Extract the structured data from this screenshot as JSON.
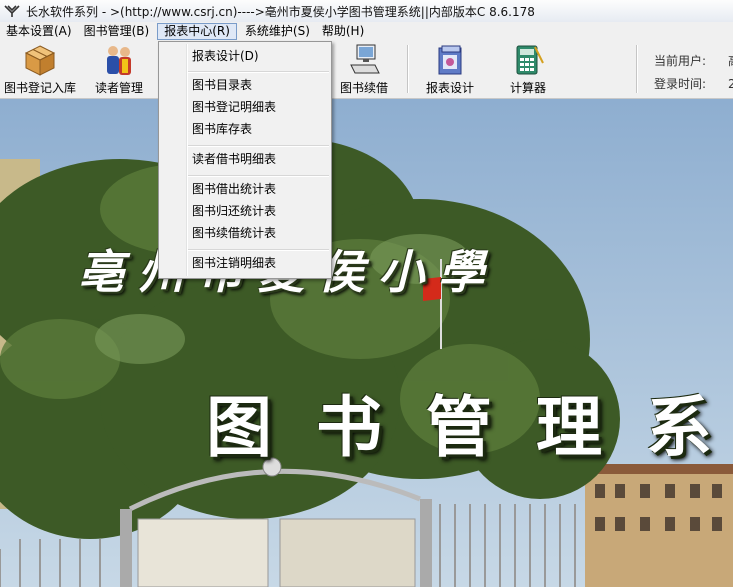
{
  "window": {
    "title": "长水软件系列 - >(http://www.csrj.cn)---->亳州市夏侯小学图书管理系统||内部版本C 8.6.178"
  },
  "menubar": {
    "items": [
      {
        "label": "基本设置(A)"
      },
      {
        "label": "图书管理(B)"
      },
      {
        "label": "报表中心(R)"
      },
      {
        "label": "系统维护(S)"
      },
      {
        "label": "帮助(H)"
      }
    ]
  },
  "toolbar": {
    "buttons": [
      {
        "label": "图书登记入库",
        "icon": "box-icon"
      },
      {
        "label": "读者管理",
        "icon": "readers-icon"
      },
      {
        "label": "图书续借",
        "icon": "computer-icon"
      },
      {
        "label": "报表设计",
        "icon": "report-design-icon"
      },
      {
        "label": "计算器",
        "icon": "calculator-icon"
      }
    ]
  },
  "user_info": {
    "current_user_label": "当前用户:",
    "current_user_value": "高",
    "login_time_label": "登录时间:",
    "login_time_value": "2"
  },
  "report_menu": {
    "items": [
      {
        "label": "报表设计(D)"
      },
      {
        "label": "图书目录表"
      },
      {
        "label": "图书登记明细表"
      },
      {
        "label": "图书库存表"
      },
      {
        "label": "读者借书明细表"
      },
      {
        "label": "图书借出统计表"
      },
      {
        "label": "图书归还统计表"
      },
      {
        "label": "图书续借统计表"
      },
      {
        "label": "图书注销明细表"
      }
    ]
  },
  "background": {
    "school_name": "亳州市夏侯小學",
    "system_caption": "图书管理系"
  },
  "colors": {
    "sky": "#9ab8d8",
    "foliage": "#3f5a2a",
    "menu_highlight": "#dfe8f6"
  }
}
